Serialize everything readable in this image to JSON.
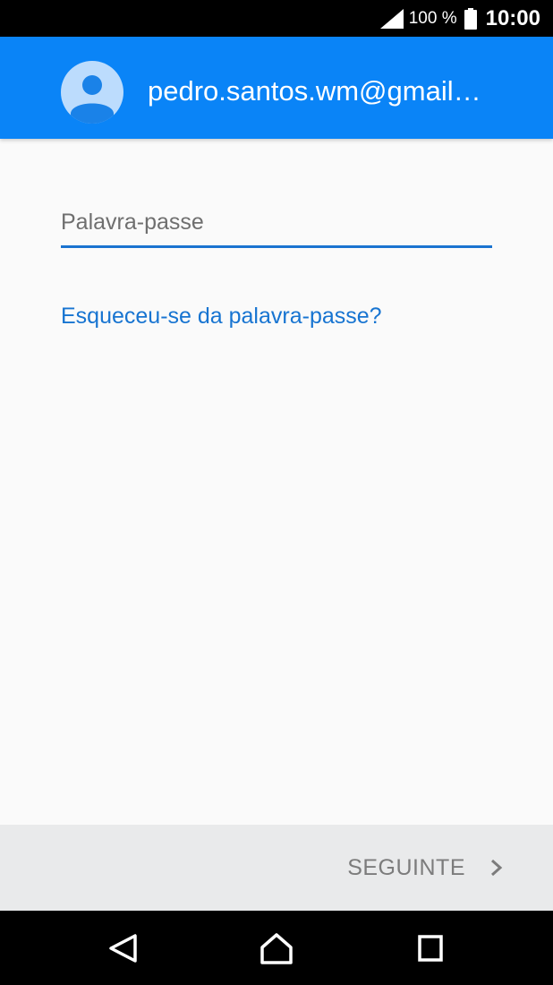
{
  "status_bar": {
    "battery_percent": "100 %",
    "time": "10:00",
    "icons": [
      "signal-icon",
      "battery-icon"
    ]
  },
  "header": {
    "account_email": "pedro.santos.wm@gmail.com",
    "avatar_icon": "account-circle-icon",
    "color": "#0a84f7"
  },
  "form": {
    "password_value": "",
    "password_placeholder": "Palavra-passe",
    "forgot_password_label": "Esqueceu-se da palavra-passe?",
    "accent_color": "#1a73d0"
  },
  "footer": {
    "next_label": "SEGUINTE",
    "next_icon": "chevron-right-icon"
  },
  "nav": {
    "icons": [
      "back-icon",
      "home-icon",
      "recents-icon"
    ]
  }
}
